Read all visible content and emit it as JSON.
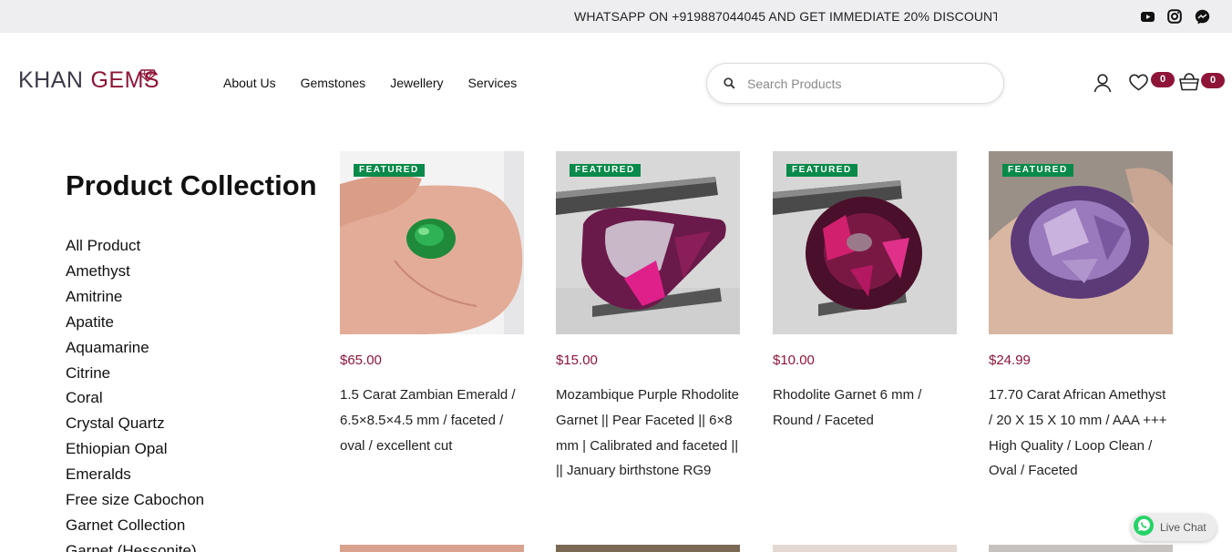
{
  "announcement": {
    "text": "WHATSAPP ON +919887044045 AND GET IMMEDIATE 20% DISCOUNT"
  },
  "social_icons": [
    "youtube-icon",
    "instagram-icon",
    "messenger-icon"
  ],
  "logo": {
    "word1": "KHAN",
    "word2": "GEMS"
  },
  "nav": [
    "About Us",
    "Gemstones",
    "Jewellery",
    "Services"
  ],
  "search": {
    "placeholder": "Search Products",
    "value": ""
  },
  "header_icons": {
    "account": "user-icon",
    "wishlist": "heart-icon",
    "cart": "basket-icon",
    "wishlist_count": "0",
    "cart_count": "0"
  },
  "sidebar": {
    "title": "Product Collection",
    "categories": [
      "All Product",
      "Amethyst",
      "Amitrine",
      "Apatite",
      "Aquamarine",
      "Citrine",
      "Coral",
      "Crystal Quartz",
      "Ethiopian Opal",
      "Emeralds",
      "Free size Cabochon",
      "Garnet Collection",
      "Garnet (Hessonite)"
    ]
  },
  "products": [
    {
      "badge": "FEATURED",
      "price": "$65.00",
      "name": "1.5 Carat Zambian Emerald / 6.5×8.5×4.5 mm / faceted / oval / excellent cut"
    },
    {
      "badge": "FEATURED",
      "price": "$15.00",
      "name": "Mozambique Purple Rhodolite Garnet || Pear Faceted || 6×8 mm | Calibrated and faceted || || January birthstone RG9"
    },
    {
      "badge": "FEATURED",
      "price": "$10.00",
      "name": "Rhodolite Garnet 6 mm / Round / Faceted"
    },
    {
      "badge": "FEATURED",
      "price": "$24.99",
      "name": "17.70 Carat African Amethyst / 20 X 15 X 10 mm / AAA +++ High Quality / Loop Clean / Oval / Faceted"
    }
  ],
  "live_chat": {
    "label": "Live Chat"
  },
  "colors": {
    "brand": "#8e1537",
    "featured_badge": "#0a8a4a",
    "topbar": "#eeeef0"
  }
}
